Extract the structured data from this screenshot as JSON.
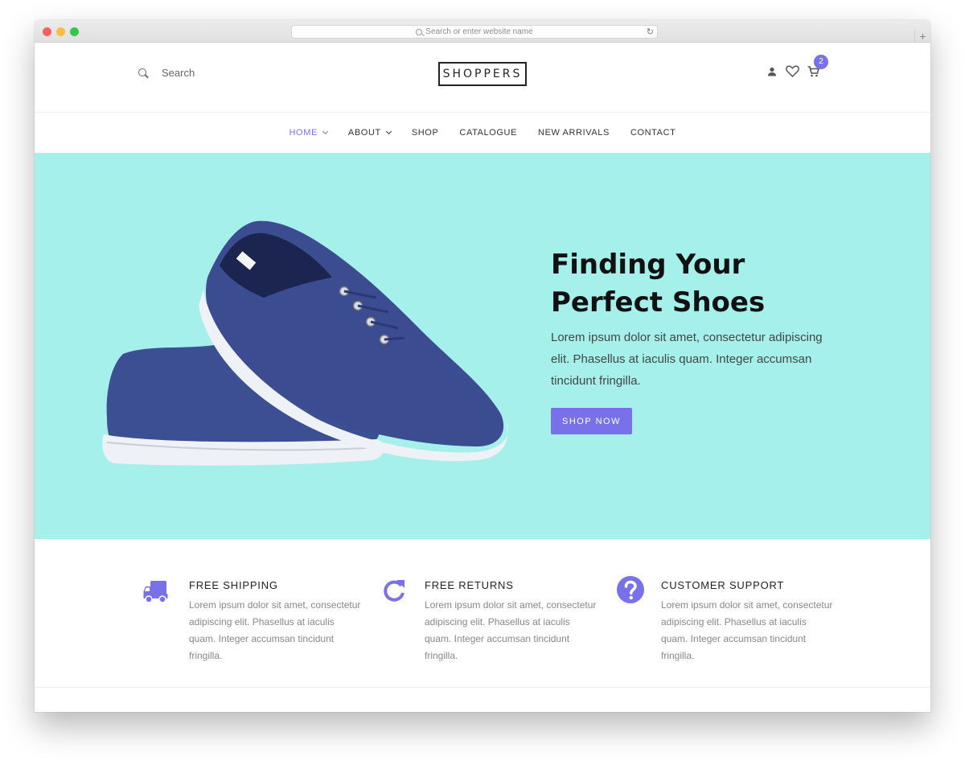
{
  "browser": {
    "address_placeholder": "Search or enter website name",
    "reload_glyph": "↻",
    "newtab_glyph": "+"
  },
  "header": {
    "search_label": "Search",
    "logo": "SHOPPERS",
    "cart_count": "2",
    "icons": [
      "user-icon",
      "heart-icon",
      "cart-icon"
    ]
  },
  "nav": {
    "items": [
      {
        "label": "HOME",
        "active": true,
        "dropdown": true
      },
      {
        "label": "ABOUT",
        "active": false,
        "dropdown": true
      },
      {
        "label": "SHOP",
        "active": false,
        "dropdown": false
      },
      {
        "label": "CATALOGUE",
        "active": false,
        "dropdown": false
      },
      {
        "label": "NEW ARRIVALS",
        "active": false,
        "dropdown": false
      },
      {
        "label": "CONTACT",
        "active": false,
        "dropdown": false
      }
    ]
  },
  "hero": {
    "title_line1": "Finding Your",
    "title_line2": "Perfect Shoes",
    "text": "Lorem ipsum dolor sit amet, consectetur adipiscing elit. Phasellus at iaculis quam. Integer accumsan tincidunt fringilla.",
    "button": "SHOP NOW"
  },
  "features": [
    {
      "icon": "truck-icon",
      "title": "FREE SHIPPING",
      "text": "Lorem ipsum dolor sit amet, consectetur adipiscing elit. Phasellus at iaculis quam. Integer accumsan tincidunt fringilla."
    },
    {
      "icon": "refresh-icon",
      "title": "FREE RETURNS",
      "text": "Lorem ipsum dolor sit amet, consectetur adipiscing elit. Phasellus at iaculis quam. Integer accumsan tincidunt fringilla."
    },
    {
      "icon": "help-icon",
      "title": "CUSTOMER SUPPORT",
      "text": "Lorem ipsum dolor sit amet, consectetur adipiscing elit. Phasellus at iaculis quam. Integer accumsan tincidunt fringilla."
    }
  ],
  "colors": {
    "accent": "#7971ea",
    "hero_bg": "#a6f0eb"
  }
}
